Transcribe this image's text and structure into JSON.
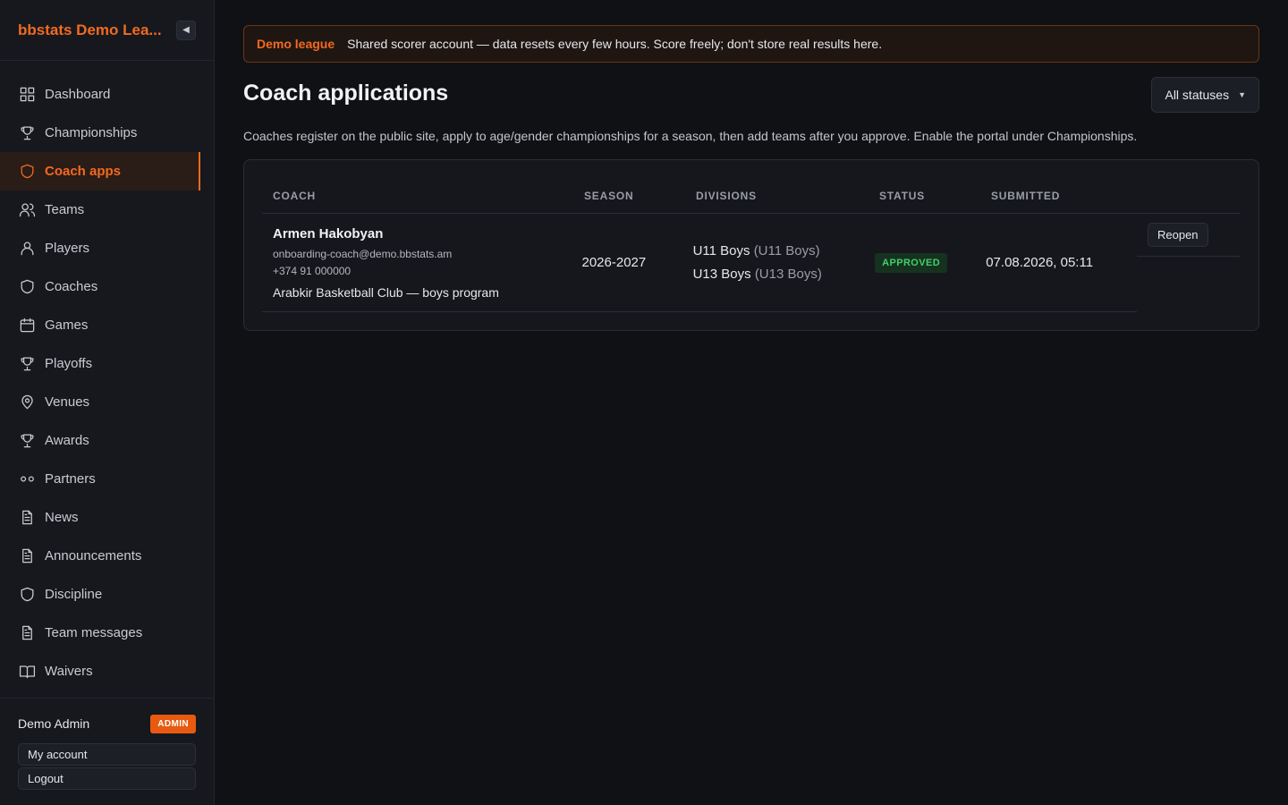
{
  "app": {
    "brand_title": "bbstats Demo Lea..."
  },
  "sidebar": {
    "items": [
      {
        "label": "Dashboard",
        "icon": "dashboard-icon"
      },
      {
        "label": "Championships",
        "icon": "trophy-icon"
      },
      {
        "label": "Coach apps",
        "icon": "shield-icon",
        "active": true
      },
      {
        "label": "Teams",
        "icon": "users-icon"
      },
      {
        "label": "Players",
        "icon": "user-icon"
      },
      {
        "label": "Coaches",
        "icon": "shield-icon"
      },
      {
        "label": "Games",
        "icon": "calendar-icon"
      },
      {
        "label": "Playoffs",
        "icon": "trophy-icon"
      },
      {
        "label": "Venues",
        "icon": "map-pin-icon"
      },
      {
        "label": "Awards",
        "icon": "trophy-icon"
      },
      {
        "label": "Partners",
        "icon": "link-icon"
      },
      {
        "label": "News",
        "icon": "document-icon"
      },
      {
        "label": "Announcements",
        "icon": "document-icon"
      },
      {
        "label": "Discipline",
        "icon": "shield-icon"
      },
      {
        "label": "Team messages",
        "icon": "document-icon"
      },
      {
        "label": "Waivers",
        "icon": "book-icon"
      }
    ],
    "user_name": "Demo Admin",
    "role_badge": "ADMIN",
    "my_account": "My account",
    "logout": "Logout"
  },
  "banner": {
    "tag": "Demo league",
    "text": "Shared scorer account — data resets every few hours. Score freely; don't store real results here."
  },
  "page": {
    "title": "Coach applications",
    "filter_label": "All statuses",
    "description": "Coaches register on the public site, apply to age/gender championships for a season, then add teams after you approve. Enable the portal under Championships."
  },
  "table": {
    "headers": {
      "coach": "COACH",
      "season": "SEASON",
      "divisions": "DIVISIONS",
      "status": "STATUS",
      "submitted": "SUBMITTED"
    },
    "rows": [
      {
        "coach_name": "Armen Hakobyan",
        "email": "onboarding-coach@demo.bbstats.am",
        "phone": "+374 91 000000",
        "club": "Arabkir Basketball Club — boys program",
        "season": "2026-2027",
        "divisions": [
          {
            "name": "U11 Boys",
            "sub": "(U11 Boys)"
          },
          {
            "name": "U13 Boys",
            "sub": "(U13 Boys)"
          }
        ],
        "status": "APPROVED",
        "submitted": "07.08.2026, 05:11",
        "action": "Reopen"
      }
    ]
  },
  "colors": {
    "accent": "#f26a21",
    "approved": "#3fcf6e",
    "background": "#0f1115"
  }
}
